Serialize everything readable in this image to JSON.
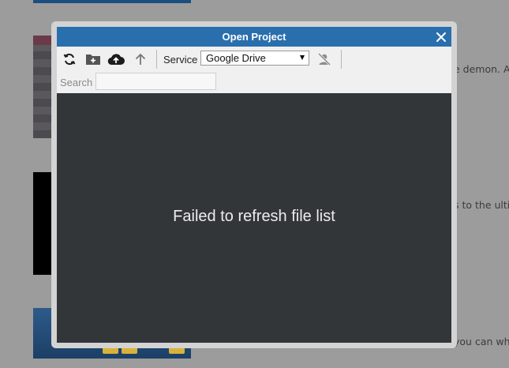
{
  "background": {
    "snippets": [
      "e demon. An",
      "s to the ultim",
      "you can whi"
    ]
  },
  "dialog": {
    "title": "Open Project",
    "toolbar": {
      "refresh_icon": "refresh-icon",
      "new_folder_icon": "new-folder-icon",
      "upload_icon": "cloud-upload-icon",
      "up_icon": "arrow-up-icon",
      "service_label": "Service",
      "service_selected": "Google Drive",
      "account_icon": "user-off-icon"
    },
    "search": {
      "label": "Search",
      "value": ""
    },
    "file_list": {
      "message": "Failed to refresh file list"
    },
    "colors": {
      "titlebar": "#2a6fad",
      "file_area": "#323639"
    }
  }
}
